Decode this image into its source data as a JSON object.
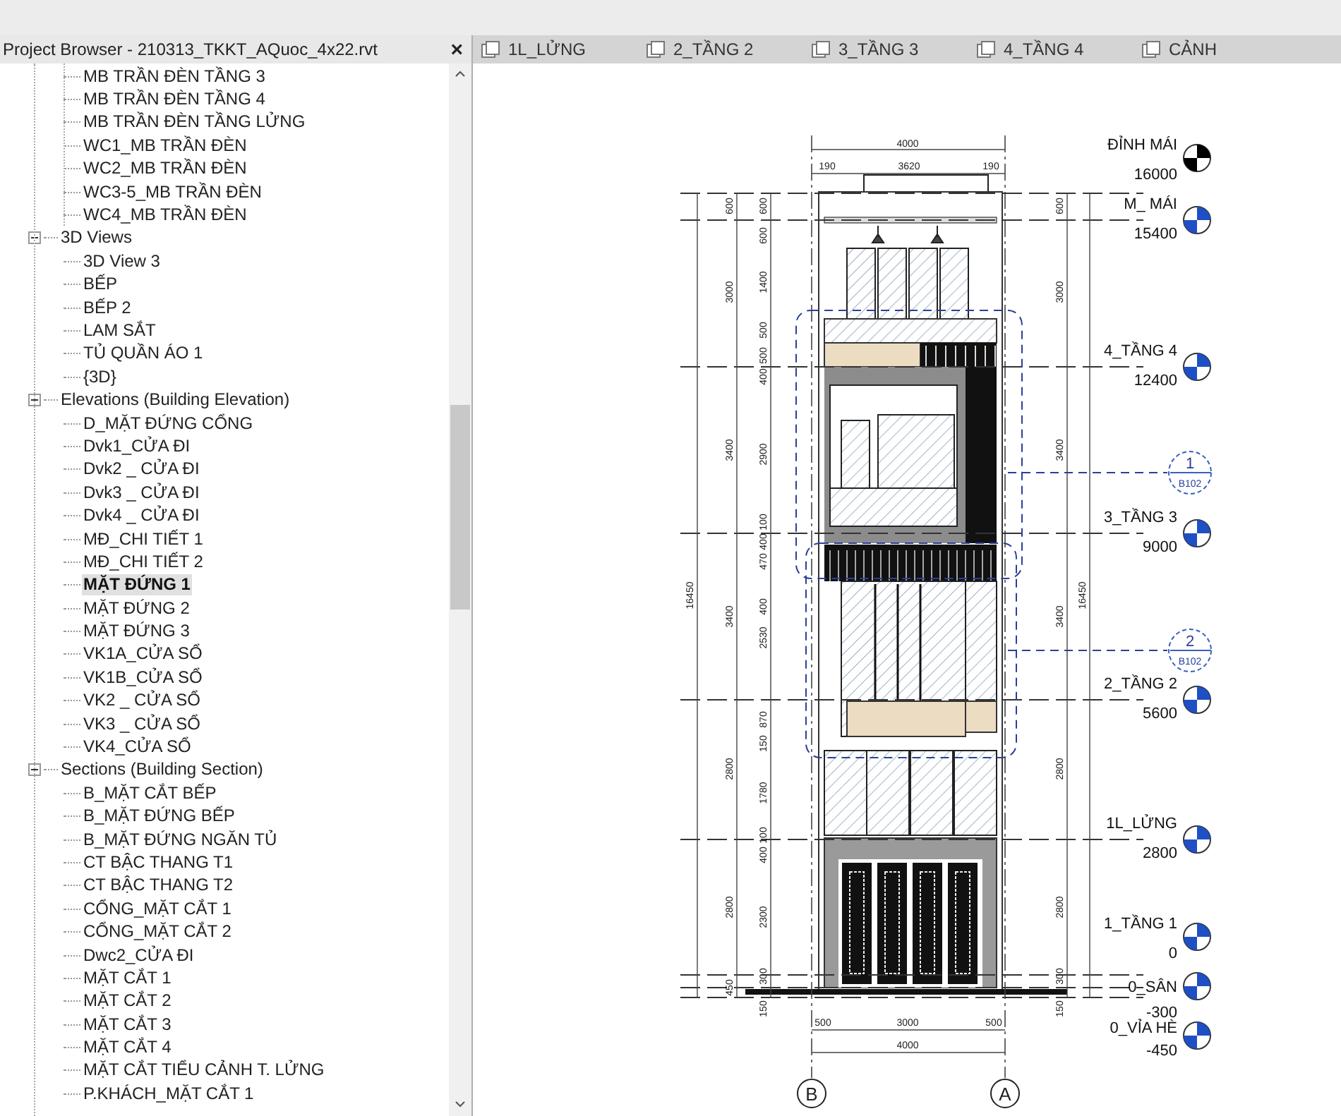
{
  "project_browser": {
    "title": "Project Browser - 210313_TKKT_AQuoc_4x22.rvt",
    "close": "×",
    "continued_items": [
      {
        "label": "MB TRẦN ĐÈN TẦNG 3",
        "selected": false
      },
      {
        "label": "MB TRẦN ĐÈN TẦNG 4",
        "selected": false
      },
      {
        "label": "MB TRẦN ĐÈN TẦNG LỬNG",
        "selected": false
      },
      {
        "label": "WC1_MB TRẦN ĐÈN",
        "selected": false
      },
      {
        "label": "WC2_MB TRẦN ĐÈN",
        "selected": false
      },
      {
        "label": "WC3-5_MB TRẦN ĐÈN",
        "selected": false
      },
      {
        "label": "WC4_MB TRẦN ĐÈN",
        "selected": false
      }
    ],
    "groups": [
      {
        "label": "3D Views",
        "expanded": true,
        "children": [
          {
            "label": "3D View 3",
            "selected": false
          },
          {
            "label": "BẾP",
            "selected": false
          },
          {
            "label": "BẾP 2",
            "selected": false
          },
          {
            "label": "LAM SẮT",
            "selected": false
          },
          {
            "label": "TỦ QUẦN ÁO 1",
            "selected": false
          },
          {
            "label": "{3D}",
            "selected": false
          }
        ]
      },
      {
        "label": "Elevations (Building Elevation)",
        "expanded": true,
        "children": [
          {
            "label": "D_MẶT ĐỨNG CỔNG",
            "selected": false
          },
          {
            "label": "Dvk1_CỬA ĐI",
            "selected": false
          },
          {
            "label": "Dvk2 _ CỬA ĐI",
            "selected": false
          },
          {
            "label": "Dvk3 _ CỬA ĐI",
            "selected": false
          },
          {
            "label": "Dvk4 _ CỬA ĐI",
            "selected": false
          },
          {
            "label": "MĐ_CHI TIẾT 1",
            "selected": false
          },
          {
            "label": "MĐ_CHI TIẾT 2",
            "selected": false
          },
          {
            "label": "MẶT ĐỨNG 1",
            "selected": true
          },
          {
            "label": "MẶT ĐỨNG 2",
            "selected": false
          },
          {
            "label": "MẶT ĐỨNG 3",
            "selected": false
          },
          {
            "label": "VK1A_CỬA SỔ",
            "selected": false
          },
          {
            "label": "VK1B_CỬA SỔ",
            "selected": false
          },
          {
            "label": "VK2 _ CỬA SỔ",
            "selected": false
          },
          {
            "label": "VK3 _ CỬA SỔ",
            "selected": false
          },
          {
            "label": "VK4_CỬA SỔ",
            "selected": false
          }
        ]
      },
      {
        "label": "Sections (Building Section)",
        "expanded": true,
        "children": [
          {
            "label": "B_MẶT CẮT BẾP",
            "selected": false
          },
          {
            "label": "B_MẶT ĐỨNG BẾP",
            "selected": false
          },
          {
            "label": "B_MẶT ĐỨNG NGĂN TỦ",
            "selected": false
          },
          {
            "label": "CT BẬC THANG T1",
            "selected": false
          },
          {
            "label": "CT BẬC THANG T2",
            "selected": false
          },
          {
            "label": "CỔNG_MẶT CẮT 1",
            "selected": false
          },
          {
            "label": "CỔNG_MẶT CẮT 2",
            "selected": false
          },
          {
            "label": "Dwc2_CỬA ĐI",
            "selected": false
          },
          {
            "label": "MẶT CẮT 1",
            "selected": false
          },
          {
            "label": "MẶT CẮT 2",
            "selected": false
          },
          {
            "label": "MẶT CẮT 3",
            "selected": false
          },
          {
            "label": "MẶT CẮT 4",
            "selected": false
          },
          {
            "label": "MẶT CẮT TIỂU CẢNH T. LỬNG",
            "selected": false
          },
          {
            "label": "P.KHÁCH_MẶT CẮT 1",
            "selected": false
          }
        ]
      }
    ]
  },
  "tabs": [
    {
      "label": "1L_LỬNG",
      "selected": false
    },
    {
      "label": "2_TẦNG 2",
      "selected": false
    },
    {
      "label": "3_TẦNG 3",
      "selected": false
    },
    {
      "label": "4_TẦNG 4",
      "selected": false
    },
    {
      "label": "CẢNH",
      "selected": false
    }
  ],
  "levels": [
    {
      "name": "ĐỈNH MÁI",
      "elevation": "16000",
      "color": "#000000"
    },
    {
      "name": "M_ MÁI",
      "elevation": "15400",
      "color": "#1f4fc4"
    },
    {
      "name": "4_TẦNG 4",
      "elevation": "12400",
      "color": "#1f4fc4"
    },
    {
      "name": "3_TẦNG 3",
      "elevation": "9000",
      "color": "#1f4fc4"
    },
    {
      "name": "2_TẦNG 2",
      "elevation": "5600",
      "color": "#1f4fc4"
    },
    {
      "name": "1L_LỬNG",
      "elevation": "2800",
      "color": "#1f4fc4"
    },
    {
      "name": "1_TẦNG 1",
      "elevation": "0",
      "color": "#1f4fc4"
    },
    {
      "name": "0_SÂN",
      "elevation": "-300",
      "color": "#1f4fc4"
    },
    {
      "name": "0_VỈA HÈ",
      "elevation": "-450",
      "color": "#1f4fc4"
    }
  ],
  "section_callouts": [
    {
      "number": "1",
      "sheet": "B102"
    },
    {
      "number": "2",
      "sheet": "B102"
    }
  ],
  "grid_bubbles": [
    "B",
    "A"
  ],
  "dimensions": {
    "top_overall": "4000",
    "top_parts": [
      "190",
      "3620",
      "190"
    ],
    "left_outer": [
      "600",
      "3000",
      "3400",
      "3400",
      "2800",
      "2800",
      "450"
    ],
    "left_inner": [
      "600",
      "600",
      "1400",
      "500",
      "500",
      "400",
      "2900",
      "100",
      "400",
      "470",
      "400",
      "2530",
      "870",
      "150",
      "1780",
      "100",
      "400",
      "2300",
      "300",
      "150"
    ],
    "left_total": "16450",
    "right_chain": [
      "600",
      "3000",
      "3400",
      "3400",
      "2800",
      "2800",
      "300",
      "150"
    ],
    "right_total": "16450",
    "bottom_parts": [
      "500",
      "3000",
      "500"
    ],
    "bottom_overall": "4000"
  }
}
